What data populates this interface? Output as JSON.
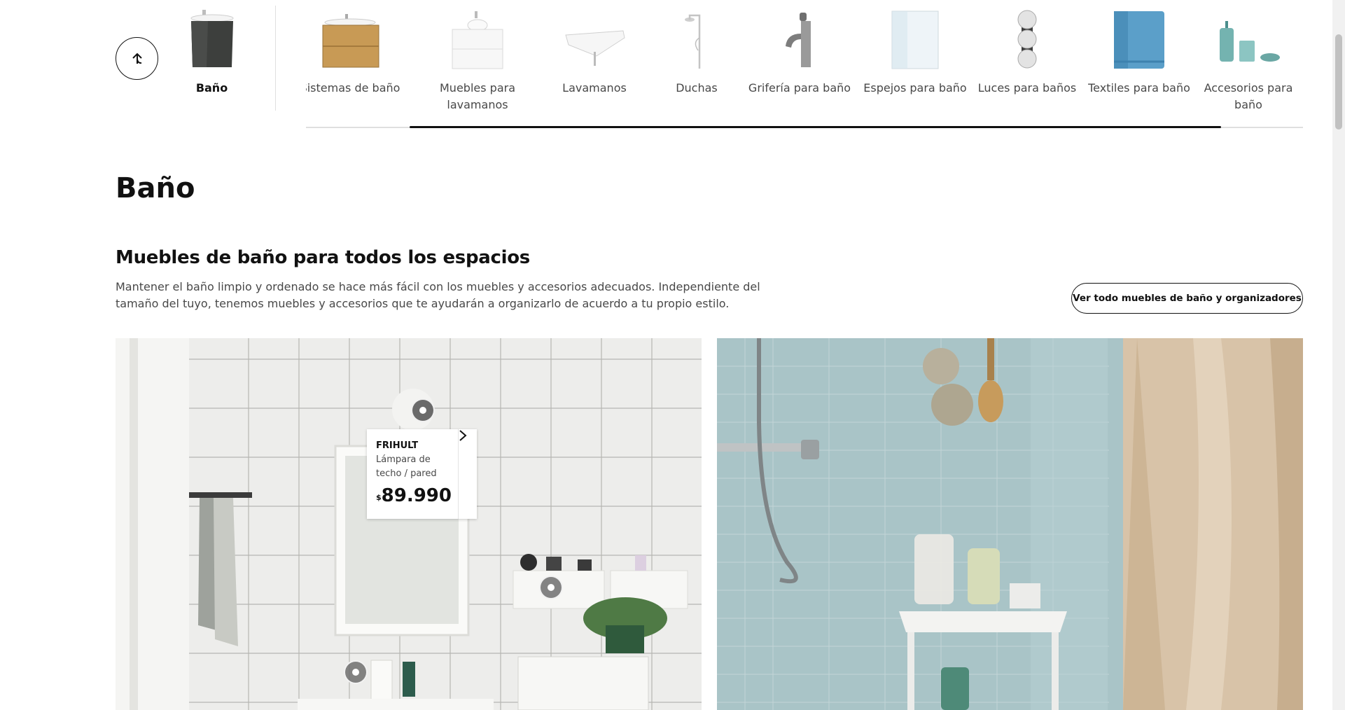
{
  "nav": {
    "current": {
      "label": "Baño",
      "icon": "bathroom-vanity-icon"
    },
    "back_icon": "arrow-up-icon",
    "items": [
      {
        "label": "Sistemas de baño",
        "icon": "wood-vanity-icon"
      },
      {
        "label": "Muebles para lavamanos",
        "icon": "white-sink-cabinet-icon"
      },
      {
        "label": "Lavamanos",
        "icon": "wash-basin-icon"
      },
      {
        "label": "Duchas",
        "icon": "shower-icon"
      },
      {
        "label": "Grifería para baño",
        "icon": "faucet-icon"
      },
      {
        "label": "Espejos para baño",
        "icon": "mirror-icon"
      },
      {
        "label": "Luces para baños",
        "icon": "wall-lamp-icon"
      },
      {
        "label": "Textiles para baño",
        "icon": "towel-icon"
      },
      {
        "label": "Accesorios para baño",
        "icon": "soap-dispenser-icon"
      }
    ]
  },
  "page": {
    "title": "Baño",
    "section_title": "Muebles de baño para todos los espacios",
    "section_desc": "Mantener el baño limpio y ordenado se hace más fácil con los muebles y accesorios adecuados. Independiente del tamaño del tuyo, tenemos muebles y accesorios que te ayudarán a organizarlo de acuerdo a tu propio estilo.",
    "see_all_label": "Ver todo muebles de baño y organizadores"
  },
  "product_card": {
    "name": "FRIHULT",
    "description": "Lámpara de techo / pared",
    "currency": "$",
    "price": "89.990"
  },
  "colors": {
    "text": "#111111",
    "muted": "#484848",
    "tile_blue": "#a7c3c6"
  }
}
